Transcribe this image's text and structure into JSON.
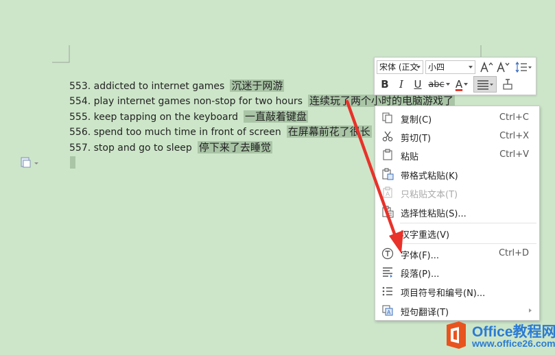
{
  "document": {
    "lines": [
      {
        "en": "553. addicted to internet games",
        "zh": "沉迷于网游"
      },
      {
        "en": "554. play internet games non-stop for two hours",
        "zh": "连续玩了两个小时的电脑游戏了"
      },
      {
        "en": "555. keep tapping on the keyboard",
        "zh": "一直敲着键盘"
      },
      {
        "en": "556. spend too much time in front of screen",
        "zh": "在屏幕前花了很长"
      },
      {
        "en": "557. stop and go to sleep",
        "zh": "停下来了去睡觉"
      }
    ]
  },
  "mini_toolbar": {
    "font_name": "宋体 (正文",
    "font_size": "小四",
    "grow_font_icon": "grow-font-icon",
    "shrink_font_icon": "shrink-font-icon",
    "line_spacing_icon": "line-spacing-icon",
    "bold": "B",
    "italic": "I",
    "underline": "U",
    "strikethrough": "abc",
    "font_color": "A",
    "font_color_value": "#e23b2e",
    "highlight_color_value": "#f3e13a",
    "align_icon": "align-icon",
    "format_painter_icon": "format-painter-icon"
  },
  "context_menu": {
    "items": [
      {
        "label": "复制(C)",
        "shortcut": "Ctrl+C",
        "icon": "copy-icon",
        "enabled": true
      },
      {
        "label": "剪切(T)",
        "shortcut": "Ctrl+X",
        "icon": "cut-icon",
        "enabled": true
      },
      {
        "label": "粘贴",
        "shortcut": "Ctrl+V",
        "icon": "paste-icon",
        "enabled": true
      },
      {
        "label": "带格式粘贴(K)",
        "shortcut": "",
        "icon": "paste-formatted-icon",
        "enabled": true
      },
      {
        "label": "只粘贴文本(T)",
        "shortcut": "",
        "icon": "paste-text-icon",
        "enabled": false
      },
      {
        "label": "选择性粘贴(S)...",
        "shortcut": "",
        "icon": "paste-special-icon",
        "enabled": true
      },
      {
        "label": "汉字重选(V)",
        "shortcut": "",
        "icon": "",
        "enabled": true
      },
      {
        "label": "字体(F)...",
        "shortcut": "Ctrl+D",
        "icon": "font-icon",
        "enabled": true
      },
      {
        "label": "段落(P)...",
        "shortcut": "",
        "icon": "paragraph-icon",
        "enabled": true
      },
      {
        "label": "项目符号和编号(N)...",
        "shortcut": "",
        "icon": "bullet-list-icon",
        "enabled": true
      },
      {
        "label": "短句翻译(T)",
        "shortcut": "",
        "icon": "translate-icon",
        "enabled": true
      }
    ]
  },
  "annotation": {
    "arrow_color": "#e8322a"
  },
  "logo": {
    "text": "Office教程网",
    "url": "www.office26.com",
    "color": "#2b7bd4",
    "box_color": "#e8541e"
  }
}
